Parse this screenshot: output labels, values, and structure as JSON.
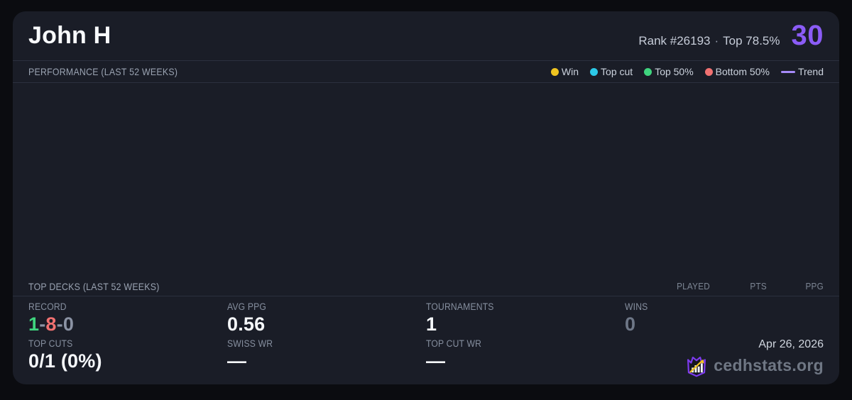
{
  "header": {
    "player_name": "John H",
    "rank_text": "Rank #26193",
    "separator": "·",
    "top_percent_text": "Top 78.5%",
    "score": "30",
    "score_color": "#8b5cf6"
  },
  "performance": {
    "title": "PERFORMANCE (LAST 52 WEEKS)",
    "legend": [
      {
        "label": "Win",
        "color": "#f0c420"
      },
      {
        "label": "Top cut",
        "color": "#2cc9e8"
      },
      {
        "label": "Top 50%",
        "color": "#3fd47e"
      },
      {
        "label": "Bottom 50%",
        "color": "#f17171"
      }
    ],
    "trend": {
      "label": "Trend",
      "color": "#a78bfa"
    },
    "chart_empty": true
  },
  "top_decks": {
    "title": "TOP DECKS (LAST 52 WEEKS)",
    "columns": {
      "played": "PLAYED",
      "pts": "PTS",
      "ppg": "PPG"
    }
  },
  "stats": {
    "record": {
      "label": "RECORD",
      "wins": "1",
      "losses": "8",
      "draws": "0",
      "separator": "-",
      "win_color": "#3fd47e",
      "loss_color": "#f17171",
      "draw_color": "#8b93a4"
    },
    "avg_ppg": {
      "label": "AVG PPG",
      "value": "0.56"
    },
    "tournaments": {
      "label": "TOURNAMENTS",
      "value": "1"
    },
    "wins": {
      "label": "WINS",
      "value": "0",
      "value_color": "#6e7787"
    },
    "top_cuts": {
      "label": "TOP CUTS",
      "value": "0/1 (0%)"
    },
    "swiss_wr": {
      "label": "SWISS WR",
      "value": "—"
    },
    "top_cut_wr": {
      "label": "TOP CUT WR",
      "value": "—"
    }
  },
  "footer": {
    "date": "Apr 26, 2026",
    "site_name": "cedhstats.org",
    "logo_icon": "crown-shield-barchart-arrow",
    "logo_outline_color": "#7c3aed",
    "logo_arrow_color": "#f0c420"
  }
}
